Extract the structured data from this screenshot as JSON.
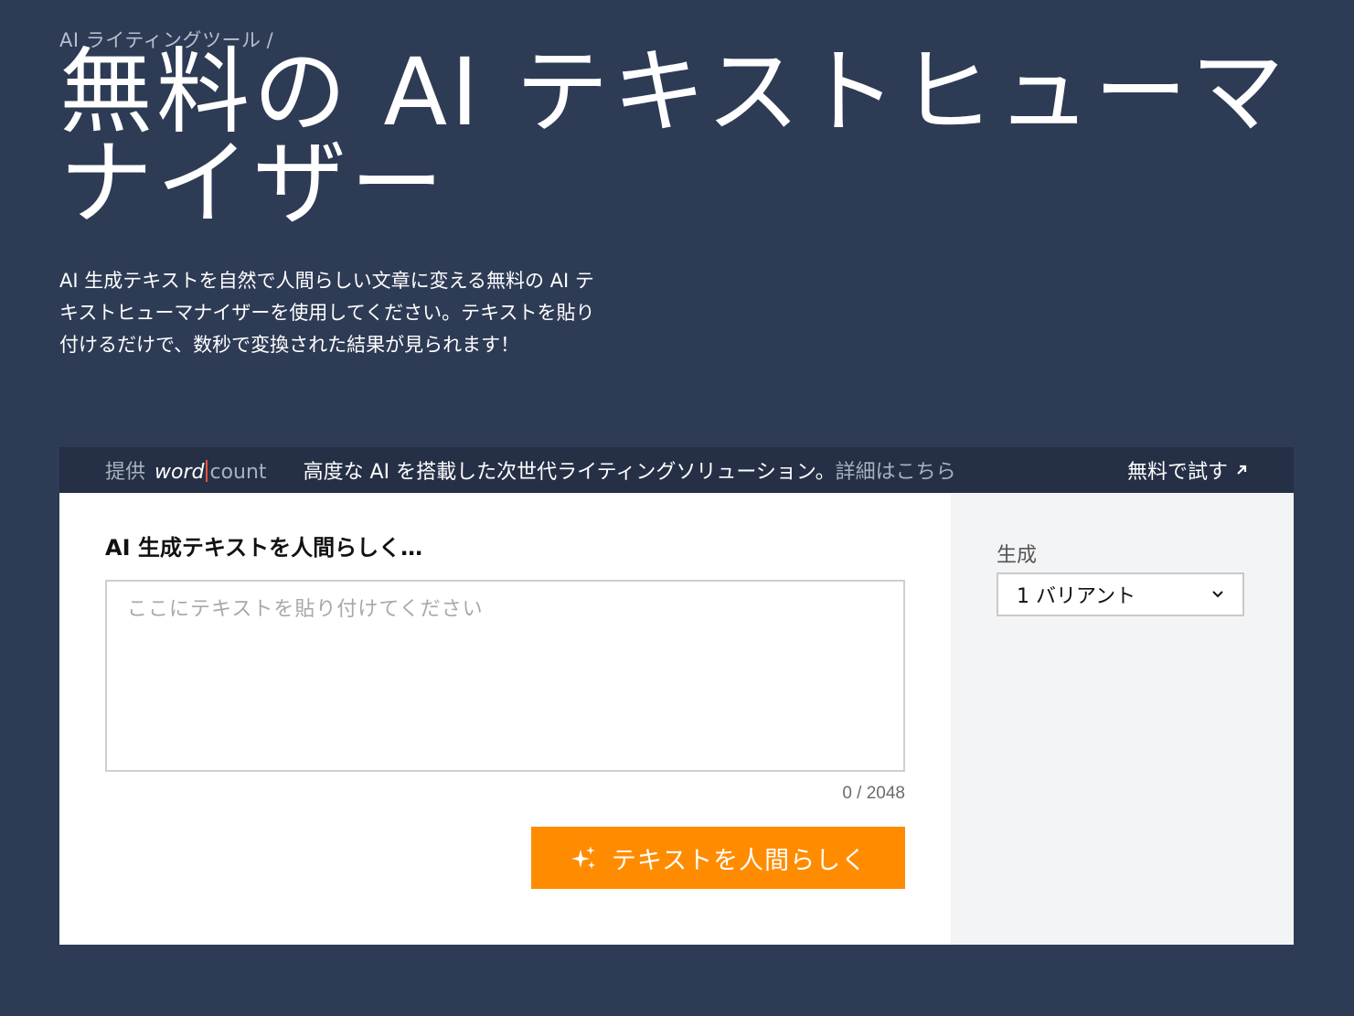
{
  "breadcrumb": {
    "parent": "AI ライティングツール",
    "separator": "/"
  },
  "page": {
    "title": "無料の AI テキストヒューマナイザー",
    "intro": "AI 生成テキストを自然で人間らしい文章に変える無料の AI テキストヒューマナイザーを使用してください。テキストを貼り付けるだけで、数秒で変換された結果が見られます！"
  },
  "promo": {
    "provided_by": "提供",
    "brand_word": "word",
    "brand_count": "count",
    "text": "高度な AI を搭載した次世代ライティングソリューション。",
    "link": "詳細はこちら",
    "try_label": "無料で試す"
  },
  "editor": {
    "heading": "AI 生成テキストを人間らしく…",
    "placeholder": "ここにテキストを貼り付けてください",
    "value": "",
    "char_count": "0 / 2048",
    "button_label": "テキストを人間らしく"
  },
  "settings": {
    "generate_label": "生成",
    "variant_selected": "1 バリアント"
  },
  "colors": {
    "background": "#2e3b55",
    "promo_bar": "#252f45",
    "accent": "#ff8c00",
    "brand_bar": "#e5533d"
  }
}
